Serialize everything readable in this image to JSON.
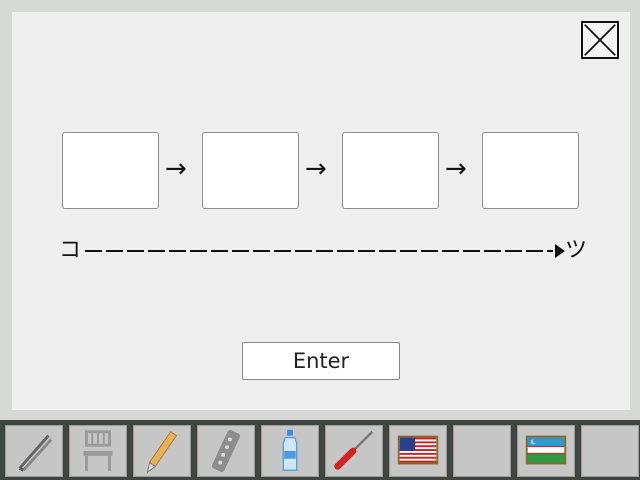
{
  "puzzle": {
    "answer_slots": [
      "",
      "",
      "",
      ""
    ],
    "arrow_glyph": "→",
    "sequence_start": "コ",
    "sequence_end": "ツ"
  },
  "buttons": {
    "enter_label": "Enter"
  },
  "inventory": {
    "items": [
      {
        "name": "tongs-icon"
      },
      {
        "name": "chair-icon"
      },
      {
        "name": "utility-knife-icon"
      },
      {
        "name": "remote-control-icon"
      },
      {
        "name": "water-bottle-icon"
      },
      {
        "name": "screwdriver-icon"
      },
      {
        "name": "us-flag-icon"
      },
      {
        "name": "empty"
      },
      {
        "name": "uzbekistan-flag-icon"
      },
      {
        "name": "empty"
      }
    ]
  },
  "colors": {
    "overlay": "#f0f0f0",
    "inventory_bar": "#3f4541",
    "slot_gray": "#c6c6c6"
  }
}
